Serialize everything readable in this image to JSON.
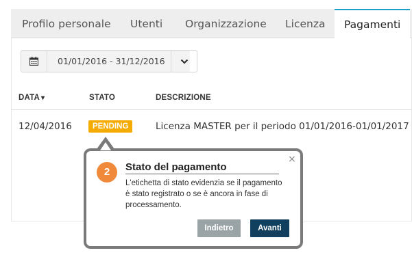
{
  "tabs": [
    {
      "label": "Profilo personale"
    },
    {
      "label": "Utenti"
    },
    {
      "label": "Organizzazione"
    },
    {
      "label": "Licenza"
    },
    {
      "label": "Pagamenti",
      "active": true
    }
  ],
  "filter": {
    "date_range": "01/01/2016 - 31/12/2016",
    "calendar_icon": "calendar-icon",
    "dropdown_icon": "chevron-down-icon"
  },
  "table": {
    "columns": [
      "DATA",
      "STATO",
      "DESCRIZIONE"
    ],
    "sort_indicator": "▾",
    "rows": [
      {
        "data": "12/04/2016",
        "stato": "PENDING",
        "descrizione": "Licenza MASTER per il periodo 01/01/2016-01/01/2017"
      }
    ]
  },
  "tour": {
    "step": "2",
    "title": "Stato del pagamento",
    "close": "×",
    "body": "L'etichetta di stato evidenzia se il pagamento è stato registrato o se è ancora in fase di processamento.",
    "back_label": "Indietro",
    "next_label": "Avanti"
  },
  "colors": {
    "accent": "#1a9fc9",
    "pending_badge": "#f5ab00",
    "step_badge": "#f08a3a",
    "next_button": "#10405e",
    "back_button": "#9aa3a6"
  }
}
